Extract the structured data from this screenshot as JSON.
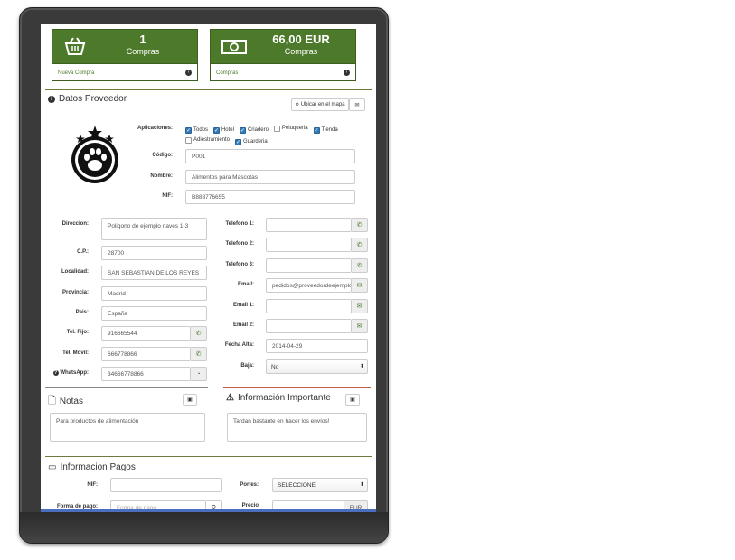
{
  "tiles": [
    {
      "count": "1",
      "caption": "Compras",
      "link": "Nueva Compra",
      "icon": "basket-icon"
    },
    {
      "count": "66,00 EUR",
      "caption": "Compras",
      "link": "Compras",
      "icon": "money-icon"
    }
  ],
  "supplier": {
    "title": "Datos Proveedor",
    "map_button": "Ubicar en el mapa",
    "apps_label": "Aplicaciones:",
    "apps": [
      {
        "label": "Todos",
        "checked": true
      },
      {
        "label": "Hotel",
        "checked": true
      },
      {
        "label": "Criadero",
        "checked": true
      },
      {
        "label": "Peluqueria",
        "checked": false
      },
      {
        "label": "Tienda",
        "checked": true
      },
      {
        "label": "Adiestramiento",
        "checked": false
      },
      {
        "label": "Guarderia",
        "checked": true
      }
    ],
    "codigo_label": "Código:",
    "codigo": "P001",
    "nombre_label": "Nombre:",
    "nombre": "Alimentos para Mascotas",
    "nif_label": "NIF:",
    "nif": "B888776655",
    "direccion_label": "Direccion:",
    "direccion": "Poligono de ejemplo naves 1-3",
    "cp_label": "C.P.:",
    "cp": "28700",
    "localidad_label": "Localidad:",
    "localidad": "SAN SEBASTIAN DE LOS REYES",
    "provincia_label": "Provincia:",
    "provincia": "Madrid",
    "pais_label": "Pais:",
    "pais": "España",
    "telfijo_label": "Tel. Fijo:",
    "telfijo": "916665544",
    "telmovil_label": "Tel. Movil:",
    "telmovil": "666778866",
    "whatsapp_label": "WhatsApp:",
    "whatsapp": "34666778866",
    "telefono1_label": "Telefono 1:",
    "telefono1": "",
    "telefono2_label": "Telefono 2:",
    "telefono2": "",
    "telefono3_label": "Telefono 3:",
    "telefono3": "",
    "email_label": "Email:",
    "email": "pedidos@proveedordeejemplo",
    "email1_label": "Email 1:",
    "email1": "",
    "email2_label": "Email 2:",
    "email2": "",
    "fechaalta_label": "Fecha Alta:",
    "fechaalta": "2014-04-29",
    "baja_label": "Baja:",
    "baja": "No"
  },
  "notas": {
    "title": "Notas",
    "text": "Para productos de alimentación"
  },
  "importante": {
    "title": "Información Importante",
    "text": "Tardan bastante en hacer los envíos!"
  },
  "pagos": {
    "title": "Informacion Pagos",
    "nif_label": "NIF:",
    "nif": "",
    "portes_label": "Portes:",
    "portes": "SELECCIONE",
    "formapago_label": "Forma de pago:",
    "formapago_placeholder": "Forma de pago",
    "precio_label": "Precio",
    "currency": "EUR"
  }
}
